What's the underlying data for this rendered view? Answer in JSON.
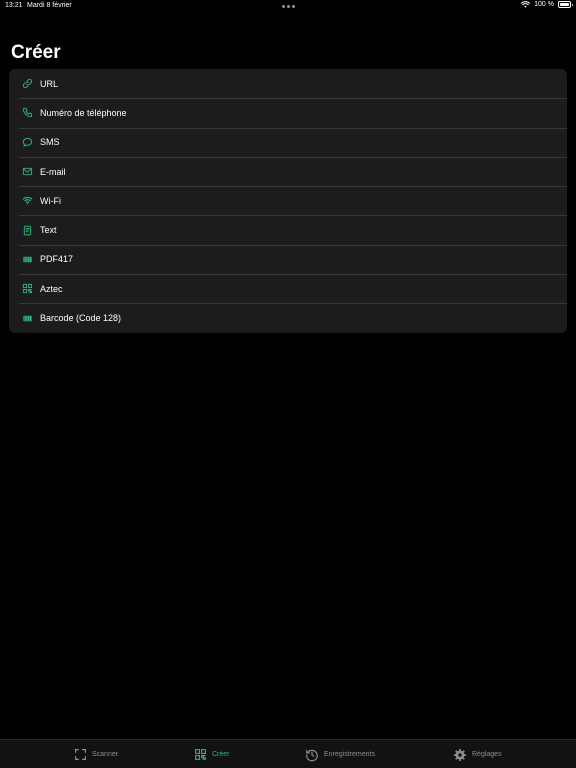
{
  "status": {
    "time": "13:21",
    "date": "Mardi 8 février",
    "battery": "100 %"
  },
  "page": {
    "title": "Créer"
  },
  "colors": {
    "accent": "#2fb67c",
    "row_bg": "#1c1c1e",
    "inactive": "#8e8e93"
  },
  "create_items": [
    {
      "label": "URL",
      "icon": "link-icon"
    },
    {
      "label": "Numéro de téléphone",
      "icon": "phone-icon"
    },
    {
      "label": "SMS",
      "icon": "message-bubble-icon"
    },
    {
      "label": "E-mail",
      "icon": "envelope-icon"
    },
    {
      "label": "Wi-Fi",
      "icon": "wifi-icon"
    },
    {
      "label": "Text",
      "icon": "text-document-icon"
    },
    {
      "label": "PDF417",
      "icon": "barcode-icon"
    },
    {
      "label": "Aztec",
      "icon": "qr-code-icon"
    },
    {
      "label": "Barcode (Code 128)",
      "icon": "barcode-icon"
    }
  ],
  "tabs": [
    {
      "label": "Scanner",
      "icon": "scan-frame-icon",
      "active": false
    },
    {
      "label": "Créer",
      "icon": "qr-code-icon",
      "active": true
    },
    {
      "label": "Enregistrements",
      "icon": "history-icon",
      "active": false
    },
    {
      "label": "Réglages",
      "icon": "gear-icon",
      "active": false
    }
  ]
}
